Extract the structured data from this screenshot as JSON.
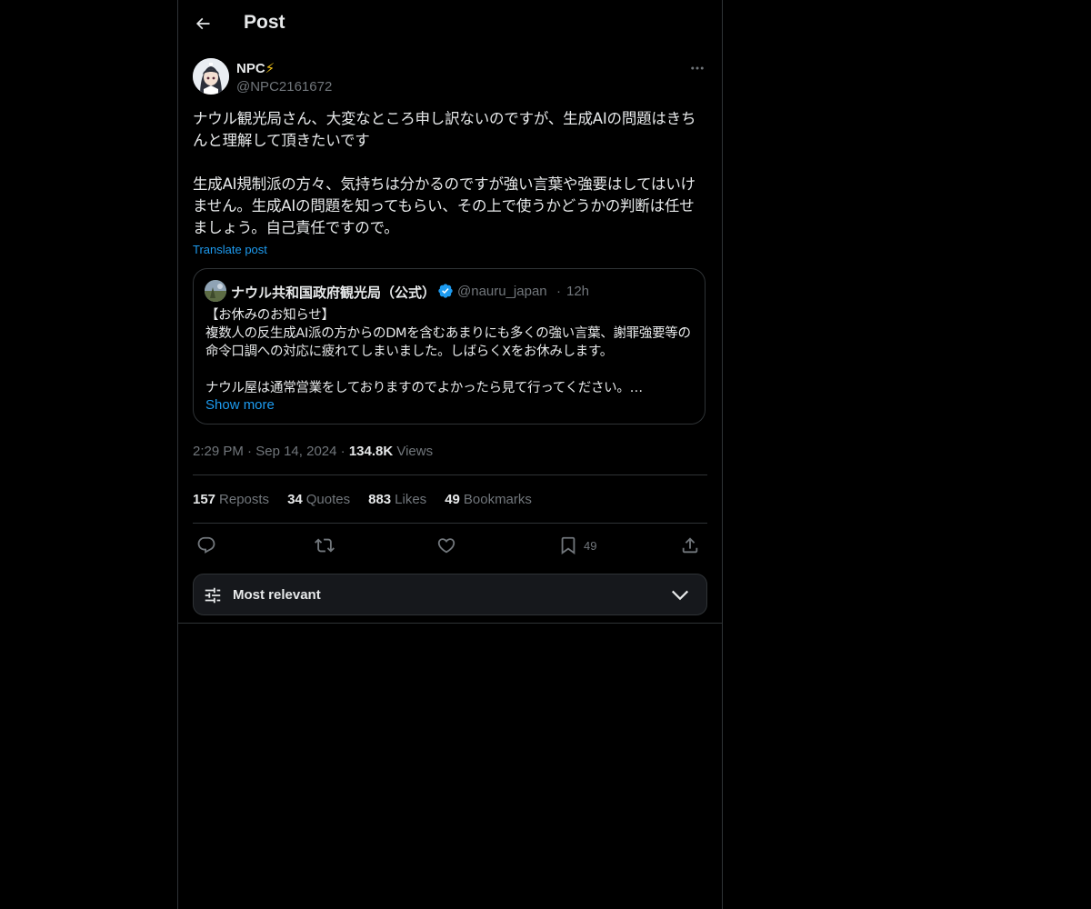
{
  "header": {
    "title": "Post"
  },
  "author": {
    "name": "NPC",
    "name_emoji": "⚡",
    "handle": "@NPC2161672"
  },
  "post": {
    "text": "ナウル観光局さん、大変なところ申し訳ないのですが、生成AIの問題はきちんと理解して頂きたいです\n\n生成AI規制派の方々、気持ちは分かるのですが強い言葉や強要はしてはいけません。生成AIの問題を知ってもらい、その上で使うかどうかの判断は任せましょう。自己責任ですので。",
    "translate_label": "Translate post"
  },
  "quote": {
    "name": "ナウル共和国政府観光局（公式）",
    "handle": "@nauru_japan",
    "separator": "·",
    "time": "12h",
    "text": "【お休みのお知らせ】\n複数人の反生成AI派の方からのDMを含むあまりにも多くの強い言葉、謝罪強要等の命令口調への対応に疲れてしまいました。しばらくXをお休みします。\n\nナウル屋は通常営業をしておりますのでよかったら見て行ってください。…",
    "show_more": "Show more"
  },
  "meta": {
    "time": "2:29 PM",
    "sep1": "·",
    "date": "Sep 14, 2024",
    "sep2": "·",
    "views_count": "134.8K",
    "views_label": "Views"
  },
  "stats": {
    "reposts_count": "157",
    "reposts_label": "Reposts",
    "quotes_count": "34",
    "quotes_label": "Quotes",
    "likes_count": "883",
    "likes_label": "Likes",
    "bookmarks_count": "49",
    "bookmarks_label": "Bookmarks"
  },
  "actions": {
    "bookmark_count": "49"
  },
  "sort": {
    "label": "Most relevant"
  },
  "colors": {
    "background": "#000000",
    "border": "#2f3336",
    "text_primary": "#e7e9ea",
    "text_secondary": "#71767b",
    "accent": "#1d9bf0"
  }
}
